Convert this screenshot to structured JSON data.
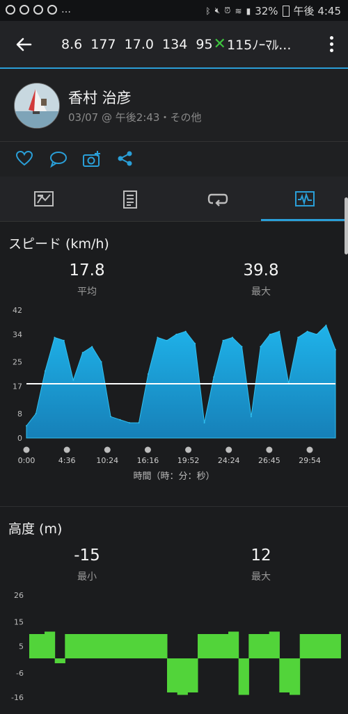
{
  "status_bar": {
    "left_text": "…",
    "battery": "32%",
    "time": "午後 4:45",
    "icons": [
      "chat-icon",
      "cloud-icon",
      "cloud-icon",
      "cloud-icon",
      "bluetooth-icon",
      "mute-icon",
      "alarm-icon",
      "wifi-icon",
      "lte-icon",
      "signal-icon",
      "battery-icon"
    ]
  },
  "app_bar": {
    "title_stats": "8.6  177  17.0  134  95",
    "title_mark": "✕",
    "title_tail": "115ﾉｰﾏﾙ...",
    "icons": [
      "back-arrow-icon",
      "more-vert-icon"
    ]
  },
  "profile": {
    "name": "香村 治彦",
    "subtitle": "03/07 @ 午後2:43・その他"
  },
  "actions": [
    "heart-icon",
    "comment-icon",
    "add-photo-icon",
    "share-icon"
  ],
  "tabs": [
    "summary-icon",
    "details-icon",
    "laps-icon",
    "chart-icon"
  ],
  "colors": {
    "accent": "#2a9fd8",
    "speed_fill": "#1aa6e0",
    "elevation_fill": "#52d43a",
    "average_line": "#ffffff"
  },
  "speed_section": {
    "title": "スピード (km/h)",
    "avg_value": "17.8",
    "avg_label": "平均",
    "max_value": "39.8",
    "max_label": "最大",
    "x_axis_title": "時間（時：分：秒）"
  },
  "elevation_section": {
    "title": "高度 (m)",
    "min_value": "-15",
    "min_label": "最小",
    "max_value": "12",
    "max_label": "最大"
  },
  "chart_data": [
    {
      "type": "area",
      "title": "スピード (km/h)",
      "xlabel": "時間（時：分：秒）",
      "ylabel": "",
      "y_ticks": [
        "0",
        "8",
        "17",
        "25",
        "34",
        "42"
      ],
      "ylim": [
        0,
        42
      ],
      "x_ticks": [
        "0:00",
        "4:36",
        "10:24",
        "16:16",
        "19:52",
        "24:24",
        "26:45",
        "29:54"
      ],
      "average": 17.8,
      "x": [
        0,
        1,
        2,
        3,
        4,
        5,
        6,
        7,
        8,
        9,
        10,
        11,
        12,
        13,
        14,
        15,
        16,
        17,
        18,
        19,
        20,
        21,
        22,
        23,
        24,
        25,
        26,
        27,
        28,
        29,
        30,
        31,
        32,
        33
      ],
      "values": [
        4,
        8,
        22,
        33,
        32,
        19,
        28,
        30,
        25,
        7,
        6,
        5,
        5,
        21,
        33,
        32,
        34,
        35,
        31,
        5,
        20,
        32,
        33,
        30,
        7,
        30,
        34,
        35,
        18,
        33,
        35,
        34,
        37,
        29
      ]
    },
    {
      "type": "area",
      "title": "高度 (m)",
      "xlabel": "",
      "ylabel": "",
      "y_ticks": [
        "26",
        "15",
        "5",
        "-6",
        "-16"
      ],
      "ylim": [
        -16,
        26
      ],
      "x": [
        0,
        1,
        2,
        3,
        4,
        5,
        6,
        7,
        8,
        9,
        10,
        11,
        12,
        13,
        14,
        15,
        16,
        17,
        18,
        19,
        20,
        21,
        22,
        23,
        24,
        25,
        26,
        27,
        28,
        29,
        30
      ],
      "values": [
        10,
        10,
        11,
        -2,
        10,
        10,
        10,
        10,
        10,
        10,
        10,
        10,
        10,
        10,
        -14,
        -15,
        -14,
        10,
        10,
        10,
        11,
        -15,
        10,
        10,
        11,
        -14,
        -15,
        10,
        10,
        10,
        10
      ]
    }
  ]
}
